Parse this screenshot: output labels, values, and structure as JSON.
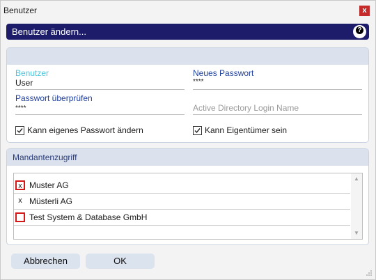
{
  "window": {
    "title": "Benutzer",
    "close_label": "x"
  },
  "header": {
    "title": "Benutzer ändern...",
    "help_label": "?"
  },
  "form": {
    "user_label": "Benutzer",
    "user_value": "User",
    "new_password_label": "Neues Passwort",
    "new_password_value": "****",
    "verify_password_label": "Passwort überprüfen",
    "verify_password_value": "****",
    "ad_login_placeholder": "Active Directory Login Name",
    "can_change_password_label": "Kann eigenes Passwort ändern",
    "can_change_password_checked": true,
    "can_be_owner_label": "Kann Eigentümer sein",
    "can_be_owner_checked": true
  },
  "mandant": {
    "title": "Mandantenzugriff",
    "items": [
      {
        "mark": "x",
        "name": "Muster AG",
        "highlighted": true
      },
      {
        "mark": "x",
        "name": "Müsterli AG",
        "highlighted": false
      },
      {
        "mark": "",
        "name": "Test System & Database GmbH",
        "highlighted": true
      }
    ]
  },
  "buttons": {
    "cancel_label": "Abbrechen",
    "ok_label": "OK"
  }
}
